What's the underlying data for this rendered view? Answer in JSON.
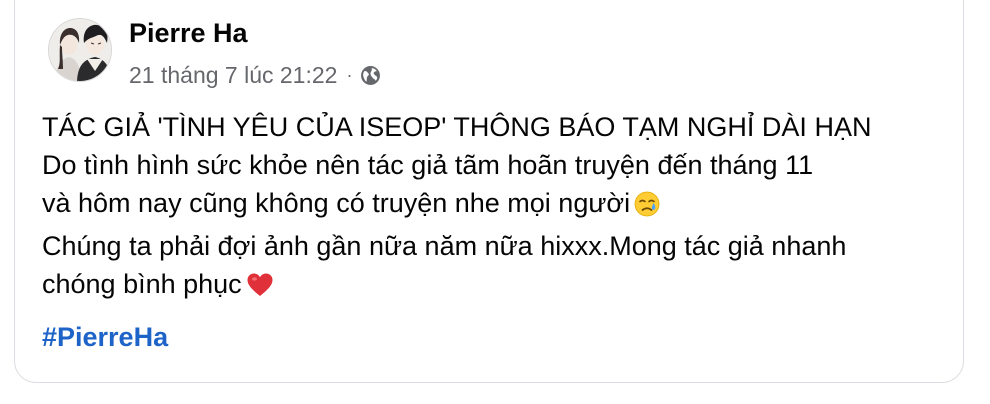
{
  "post": {
    "author": "Pierre Ha",
    "timestamp": "21 tháng 7 lúc 21:22",
    "separator": "·",
    "audience_icon": "globe-icon",
    "lines": [
      "TÁC GIẢ 'TÌNH YÊU CỦA ISEOP' THÔNG BÁO TẠM NGHỈ DÀI HẠN",
      "Do tình hình sức khỏe nên tác giả tãm hoãn truyện đến tháng 11",
      "và hôm nay cũng không có truyện nhe mọi người",
      "Chúng ta phải đợi ảnh gần nữa năm nữa hixxx.Mong tác giả nhanh",
      "chóng bình phục"
    ],
    "emojis": [
      "crying-face-emoji",
      "red-heart-emoji"
    ],
    "hashtag": "#PierreHa"
  },
  "colors": {
    "text": "#050505",
    "meta": "#65676b",
    "link": "#1e64c8",
    "border": "#dadde1",
    "heart": "#e0303a"
  }
}
